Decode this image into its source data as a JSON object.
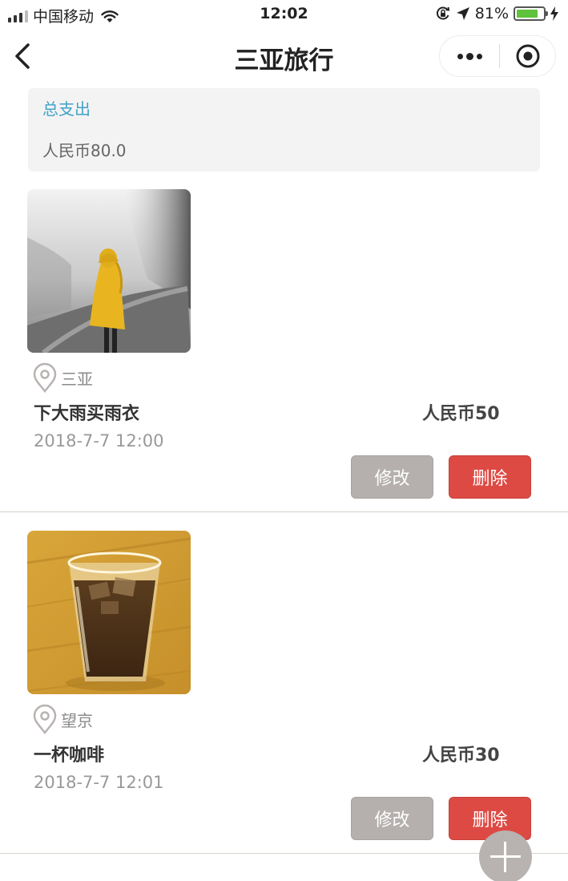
{
  "status_bar": {
    "carrier": "中国移动",
    "time": "12:02",
    "battery_percent": "81%",
    "battery_level": 0.81,
    "icons": [
      "signal-icon",
      "wifi-icon",
      "orientation-lock-icon",
      "location-arrow-icon",
      "battery-icon",
      "charging-icon"
    ]
  },
  "nav": {
    "title": "三亚旅行",
    "icons": [
      "back-arrow-icon",
      "more-dots-icon",
      "close-target-icon"
    ]
  },
  "summary": {
    "label": "总支出",
    "value": "人民币80.0"
  },
  "items": [
    {
      "location": "三亚",
      "title": "下大雨买雨衣",
      "amount": "人民币50",
      "time": "2018-7-7 12:00",
      "edit_label": "修改",
      "delete_label": "删除",
      "photo": "person-in-yellow-raincoat-on-foggy-road"
    },
    {
      "location": "望京",
      "title": "一杯咖啡",
      "amount": "人民币30",
      "time": "2018-7-7 12:01",
      "edit_label": "修改",
      "delete_label": "删除",
      "photo": "iced-coffee-glass-on-wooden-table"
    }
  ],
  "colors": {
    "summary_label": "#3fa2c8",
    "edit_button": "#b5b0ae",
    "delete_button": "#dd4a44",
    "fab": "#b8b3b1"
  }
}
